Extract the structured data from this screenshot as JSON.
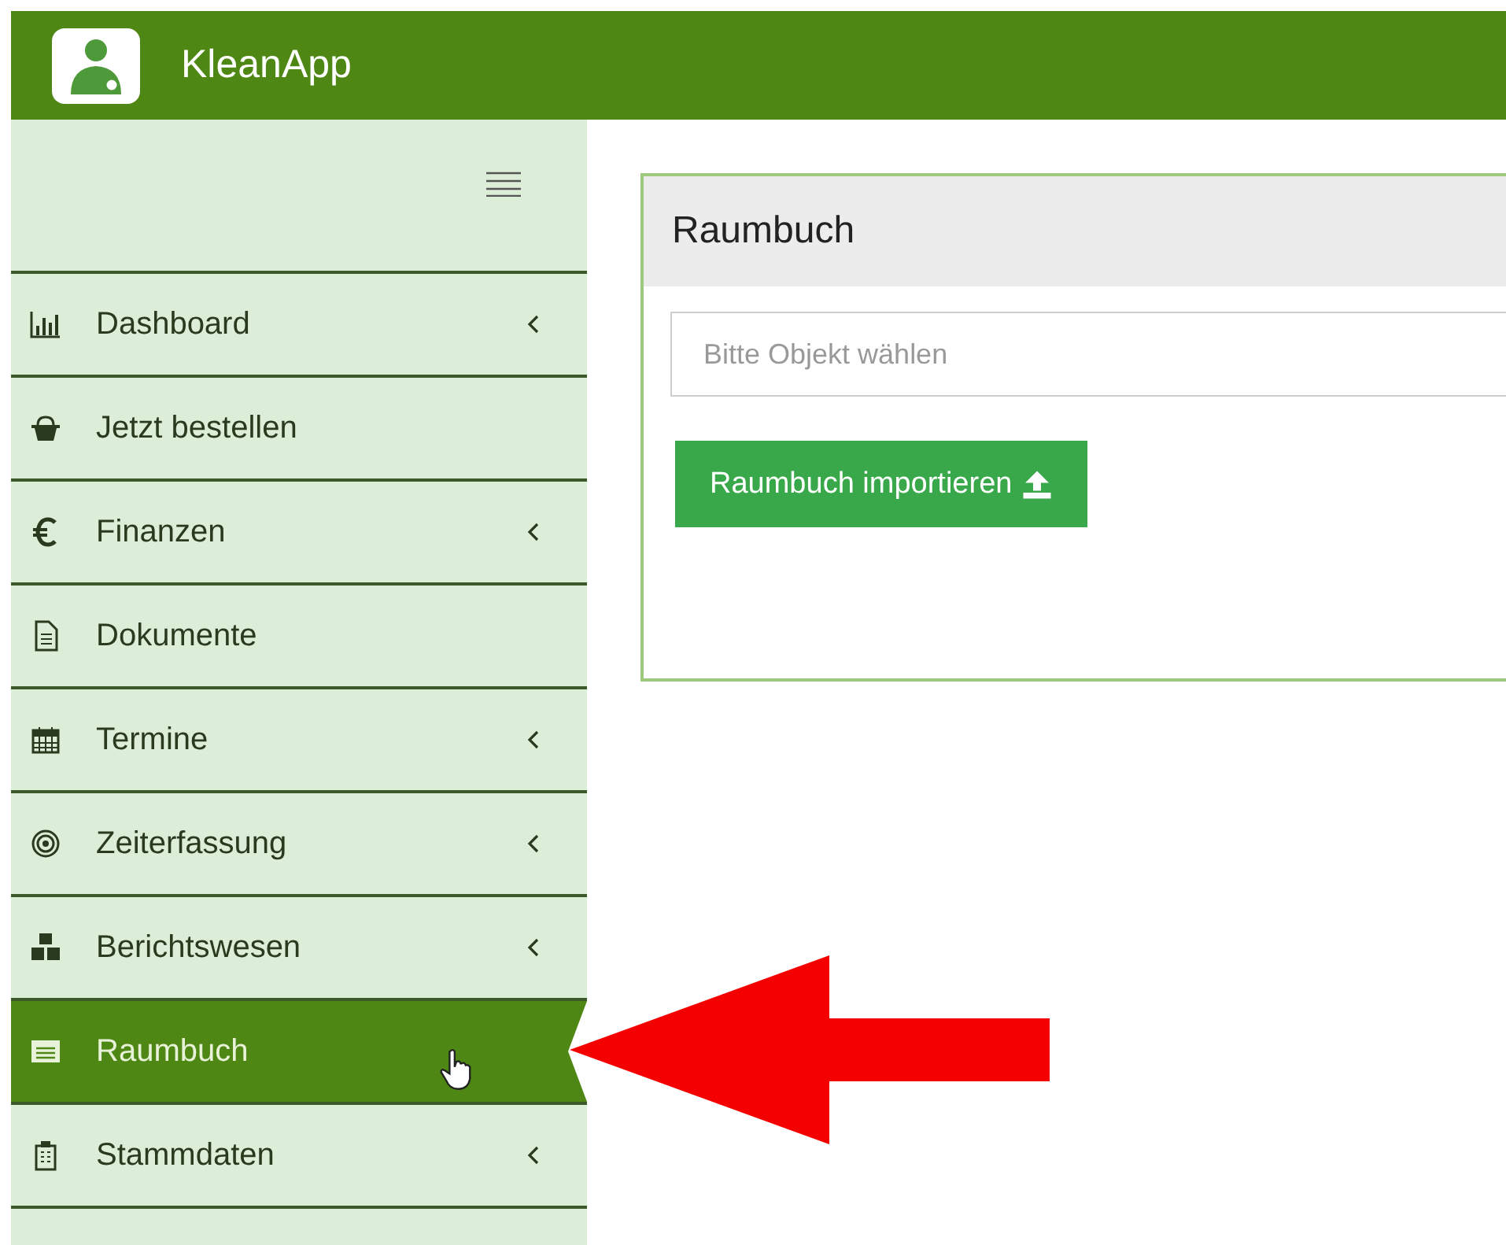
{
  "header": {
    "app_name": "KleanApp"
  },
  "sidebar": {
    "items": [
      {
        "label": "Dashboard",
        "has_submenu": true,
        "selected": false
      },
      {
        "label": "Jetzt bestellen",
        "has_submenu": false,
        "selected": false
      },
      {
        "label": "Finanzen",
        "has_submenu": true,
        "selected": false
      },
      {
        "label": "Dokumente",
        "has_submenu": false,
        "selected": false
      },
      {
        "label": "Termine",
        "has_submenu": true,
        "selected": false
      },
      {
        "label": "Zeiterfassung",
        "has_submenu": true,
        "selected": false
      },
      {
        "label": "Berichtswesen",
        "has_submenu": true,
        "selected": false
      },
      {
        "label": "Raumbuch",
        "has_submenu": false,
        "selected": true
      },
      {
        "label": "Stammdaten",
        "has_submenu": true,
        "selected": false
      }
    ]
  },
  "panel": {
    "title": "Raumbuch",
    "select": {
      "placeholder": "Bitte Objekt wählen"
    },
    "button": "Raumbuch importieren"
  }
}
